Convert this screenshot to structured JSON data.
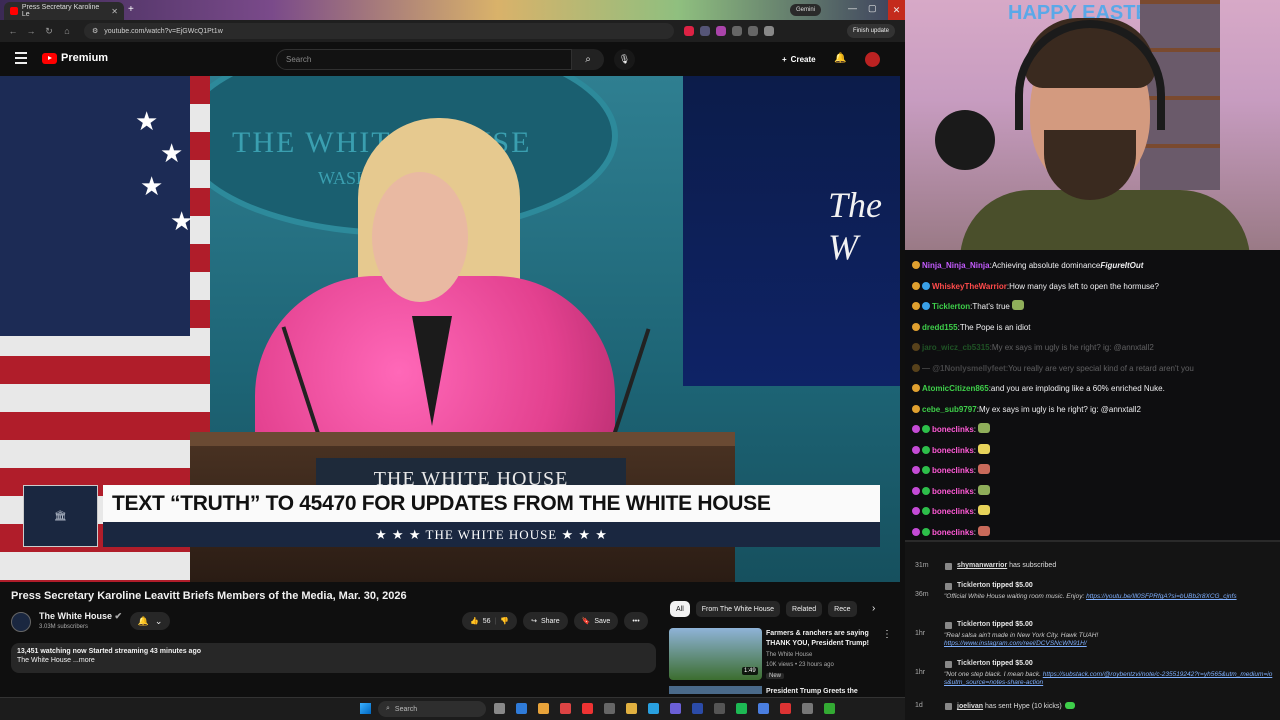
{
  "browser": {
    "tab_title": "Press Secretary Karoline Le",
    "gemini_label": "Gemini",
    "url": "youtube.com/watch?v=EjGWcQ1Pt1w",
    "finish_update": "Finish update"
  },
  "youtube": {
    "logo": "Premium",
    "search_placeholder": "Search",
    "create": "Create"
  },
  "video": {
    "wall_text": "THE WHITE HOUSE",
    "wall_text2": "WASHINGTON",
    "screen_text": "The W",
    "podium_text": "THE WHITE HOUSE",
    "lower_third_main": "TEXT “TRUTH” TO 45470 FOR UPDATES FROM THE WHITE HOUSE",
    "lower_third_sub": "★ ★ ★  THE WHITE HOUSE  ★ ★ ★"
  },
  "watch": {
    "title": "Press Secretary Karoline Leavitt Briefs Members of the Media, Mar. 30, 2026",
    "channel": "The White House",
    "subscribers": "3.03M subscribers",
    "likes": "56",
    "share": "Share",
    "save": "Save",
    "desc_line1": "13,451 watching now  Started streaming 43 minutes ago",
    "desc_line2": "The White House ...more"
  },
  "related": {
    "chips": [
      "All",
      "From The White House",
      "Related",
      "Rece"
    ],
    "items": [
      {
        "title": "Farmers & ranchers are saying THANK YOU, President Trump!",
        "channel": "The White House",
        "meta": "10K views • 23 hours ago",
        "badge": "New",
        "duration": "1:49"
      },
      {
        "title": "President Trump Greets the"
      }
    ]
  },
  "taskbar": {
    "search": "Search"
  },
  "stream": {
    "banner": "HAPPY EASTER"
  },
  "chat": [
    {
      "user": "Ninja_Ninja_Ninja",
      "sep": ":",
      "text": "Achieving absolute dominance",
      "emote_text": "FigureItOut",
      "color": "#c55cff",
      "faded": false
    },
    {
      "user": "WhiskeyTheWarrior",
      "sep": ":",
      "text": "How many days left to open the hormuse?",
      "color": "#ff4b4b",
      "faded": false
    },
    {
      "user": "Ticklerton",
      "sep": ":",
      "text": "That's true",
      "color": "#3ecf4a",
      "faded": false
    },
    {
      "user": "dredd155",
      "sep": ":",
      "text": "The Pope is an idiot",
      "color": "#3ecf4a",
      "faded": false
    },
    {
      "user": "jaro_wicz_cb5315",
      "sep": ":",
      "text": "My ex says im ugly is he right? ig: @annxtall2",
      "color": "#3ecf4a",
      "faded": true
    },
    {
      "user": "— @1Nonlysmellyfeet",
      "sep": ":",
      "text": "You really are very special kind of a retard aren't you",
      "color": "#aaaaaa",
      "faded": true
    },
    {
      "user": "AtomicCitizen865",
      "sep": ":",
      "text": "and you are imploding like a 60% enriched Nuke.",
      "color": "#3ecf4a",
      "faded": false
    },
    {
      "user": "cebe_sub9797",
      "sep": ":",
      "text": "My ex says im ugly is he right? ig: @annxtall2",
      "color": "#3ecf4a",
      "faded": false
    },
    {
      "user": "bonecIinks",
      "sep": ":",
      "text": "",
      "color": "#ff5ad6",
      "faded": false
    },
    {
      "user": "bonecIinks",
      "sep": ":",
      "text": "",
      "color": "#ff5ad6",
      "faded": false
    },
    {
      "user": "bonecIinks",
      "sep": ":",
      "text": "",
      "color": "#ff5ad6",
      "faded": false
    },
    {
      "user": "bonecIinks",
      "sep": ":",
      "text": "",
      "color": "#ff5ad6",
      "faded": false
    },
    {
      "user": "bonecIinks",
      "sep": ":",
      "text": "",
      "color": "#ff5ad6",
      "faded": false
    },
    {
      "user": "bonecIinks",
      "sep": ":",
      "text": "",
      "color": "#ff5ad6",
      "faded": false
    },
    {
      "user": "bonecIinks",
      "sep": ":",
      "text": "",
      "color": "#ff5ad6",
      "faded": false
    }
  ],
  "events": {
    "e1_time": "31m",
    "e1_user": "shymanwarrior",
    "e1_action": "has subscribed",
    "e2_time": "36m",
    "e2_user": "Ticklerton",
    "e2_action": "tipped $5.00",
    "e2_msg": "\"Official White House waiting room music. Enjoy: ",
    "e2_link": "https://youtu.be/Ill0SFPRfgA?si=bUBb2r8XCG_cjnfs",
    "e3_time": "1hr",
    "e3_user": "Ticklerton",
    "e3_action": "tipped $5.00",
    "e3_msg": "\"Real salsa ain't made in New York City. Hawk TUAH!",
    "e3_link": "https://www.instagram.com/reel/DCVSNcWN91H/",
    "e4_time": "1hr",
    "e4_user": "Ticklerton",
    "e4_action": "tipped $5.00",
    "e4_msg": "\"Not one step black. I mean back. ",
    "e4_link": "https://substack.com/@roybentzvi/note/c-235519242?r=yh565&utm_medium=ios&utm_source=notes-share-action",
    "e5_time": "1d",
    "e5_user": "joelivan",
    "e5_action": "has sent Hype (10 kicks)"
  }
}
